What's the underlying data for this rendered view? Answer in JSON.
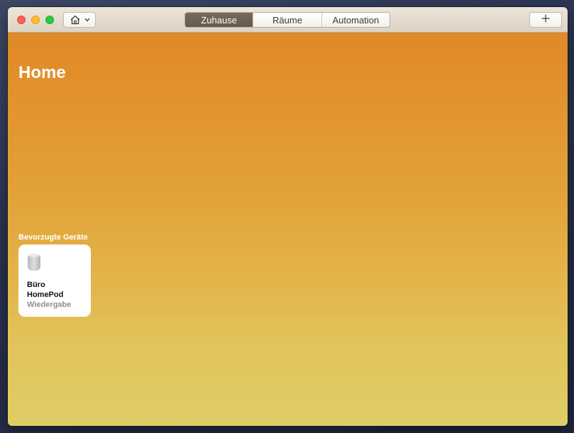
{
  "window": {
    "traffic_lights": [
      "close",
      "minimize",
      "zoom"
    ]
  },
  "toolbar": {
    "home_menu_icon": "house-icon",
    "tabs": [
      {
        "label": "Zuhause",
        "active": true
      },
      {
        "label": "Räume",
        "active": false
      },
      {
        "label": "Automation",
        "active": false
      }
    ],
    "add_icon": "plus-icon"
  },
  "main": {
    "title": "Home",
    "favorites_label": "Bevorzugte Geräte",
    "favorites": [
      {
        "icon": "homepod-icon",
        "room": "Büro",
        "name": "HomePod",
        "status": "Wiedergabe"
      }
    ]
  },
  "colors": {
    "background_top": "#e08826",
    "background_bottom": "#dfcd66",
    "active_tab": "#6e6256",
    "status_text": "#8e8e93"
  }
}
